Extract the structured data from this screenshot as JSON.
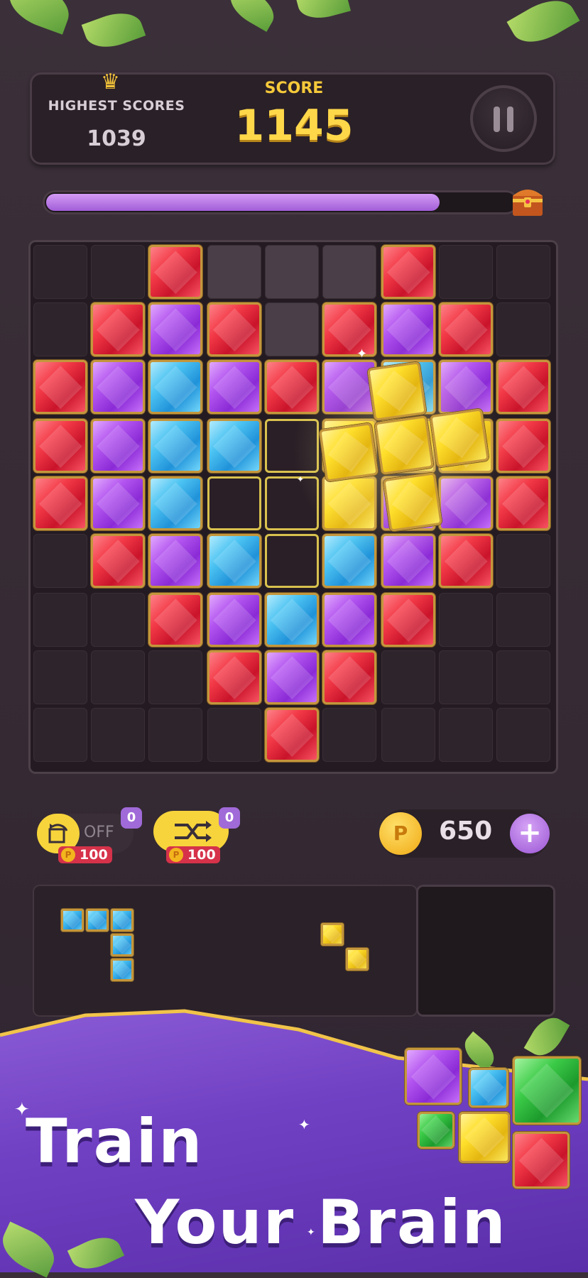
{
  "header": {
    "highest_scores_label": "HIGHEST SCORES",
    "highest_scores_value": "1039",
    "score_label": "SCORE",
    "score_value": "1145"
  },
  "progress": {
    "fraction": 0.84
  },
  "board_rows": [
    [
      "E",
      "E",
      "R",
      "L",
      "L",
      "L",
      "R",
      "E",
      "E"
    ],
    [
      "E",
      "R",
      "P",
      "R",
      "L",
      "R",
      "P",
      "R",
      "E"
    ],
    [
      "R",
      "P",
      "B",
      "P",
      "R",
      "P",
      "B",
      "P",
      "R"
    ],
    [
      "R",
      "P",
      "B",
      "B",
      "O",
      "Y",
      "Y",
      "Y",
      "R"
    ],
    [
      "R",
      "P",
      "B",
      "O",
      "O",
      "Y",
      "P",
      "P",
      "R"
    ],
    [
      "E",
      "R",
      "P",
      "B",
      "O",
      "B",
      "P",
      "R",
      "E"
    ],
    [
      "E",
      "E",
      "R",
      "P",
      "B",
      "P",
      "R",
      "E",
      "E"
    ],
    [
      "E",
      "E",
      "E",
      "R",
      "P",
      "R",
      "E",
      "E",
      "E"
    ],
    [
      "E",
      "E",
      "E",
      "E",
      "R",
      "E",
      "E",
      "E",
      "E"
    ]
  ],
  "powerups": {
    "rotate": {
      "state": "OFF",
      "count": "0",
      "cost": "100"
    },
    "shuffle": {
      "count": "0",
      "cost": "100"
    }
  },
  "coins": {
    "value": "650",
    "coin_symbol": "P",
    "plus": "+"
  },
  "promo": {
    "line1": "Train",
    "line2": "Your Brain"
  },
  "colors": {
    "red": "#f33a48",
    "purple": "#b355f0",
    "blue": "#4cc3f2",
    "yellow": "#ffdf2c",
    "green": "#3ccb48",
    "accent": "#a06ad8"
  },
  "icons": [
    "crown-icon",
    "pause-icon",
    "treasure-chest-icon",
    "rotate-icon",
    "shuffle-icon",
    "coin-icon",
    "plus-icon"
  ]
}
